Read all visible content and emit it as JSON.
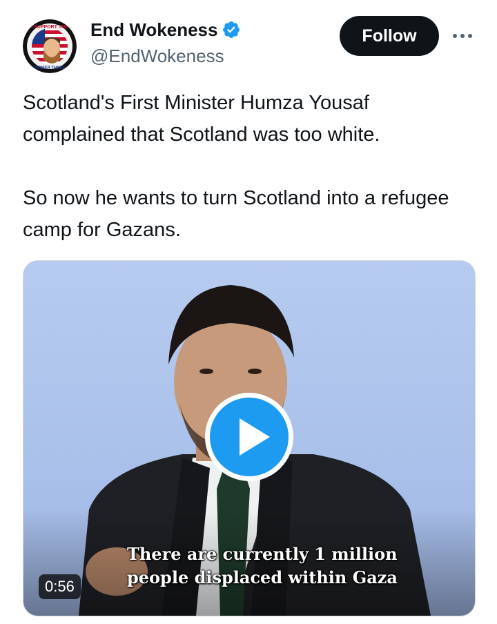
{
  "account": {
    "display_name": "End Wokeness",
    "handle": "@EndWokeness",
    "verified": true,
    "avatar_ring_text": "I SUPPORT THE",
    "avatar_bottom_text": "FORMER THINGS"
  },
  "actions": {
    "follow_label": "Follow",
    "more_icon": "more-horizontal-icon"
  },
  "tweet": {
    "paragraphs": [
      "Scotland's First Minister Humza Yousaf complained that Scotland was too white.",
      "So now he wants to turn Scotland into a refugee camp for Gazans."
    ]
  },
  "video": {
    "caption_line_1": "There are currently 1 million",
    "caption_line_2": "people displaced within Gaza",
    "duration": "0:56",
    "play_icon": "play-icon"
  },
  "colors": {
    "verified_blue": "#1d9bf0",
    "play_blue": "#1d9bf0",
    "text_primary": "#0f1419",
    "text_secondary": "#536471",
    "follow_bg": "#0f1419"
  }
}
